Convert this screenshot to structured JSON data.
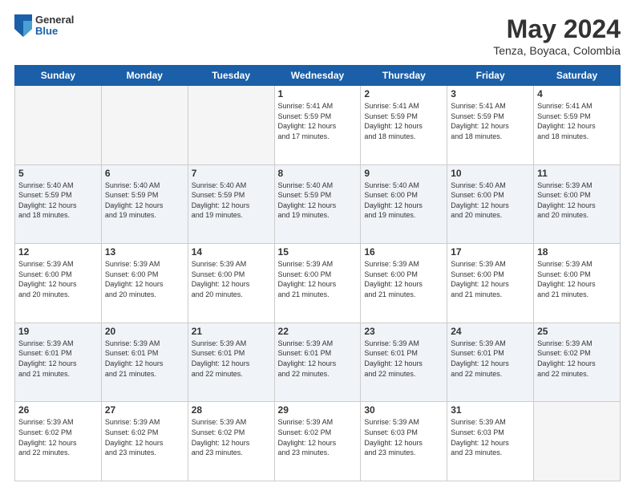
{
  "logo": {
    "general": "General",
    "blue": "Blue"
  },
  "header": {
    "title": "May 2024",
    "subtitle": "Tenza, Boyaca, Colombia"
  },
  "weekdays": [
    "Sunday",
    "Monday",
    "Tuesday",
    "Wednesday",
    "Thursday",
    "Friday",
    "Saturday"
  ],
  "weeks": [
    [
      {
        "day": "",
        "info": ""
      },
      {
        "day": "",
        "info": ""
      },
      {
        "day": "",
        "info": ""
      },
      {
        "day": "1",
        "info": "Sunrise: 5:41 AM\nSunset: 5:59 PM\nDaylight: 12 hours\nand 17 minutes."
      },
      {
        "day": "2",
        "info": "Sunrise: 5:41 AM\nSunset: 5:59 PM\nDaylight: 12 hours\nand 18 minutes."
      },
      {
        "day": "3",
        "info": "Sunrise: 5:41 AM\nSunset: 5:59 PM\nDaylight: 12 hours\nand 18 minutes."
      },
      {
        "day": "4",
        "info": "Sunrise: 5:41 AM\nSunset: 5:59 PM\nDaylight: 12 hours\nand 18 minutes."
      }
    ],
    [
      {
        "day": "5",
        "info": "Sunrise: 5:40 AM\nSunset: 5:59 PM\nDaylight: 12 hours\nand 18 minutes."
      },
      {
        "day": "6",
        "info": "Sunrise: 5:40 AM\nSunset: 5:59 PM\nDaylight: 12 hours\nand 19 minutes."
      },
      {
        "day": "7",
        "info": "Sunrise: 5:40 AM\nSunset: 5:59 PM\nDaylight: 12 hours\nand 19 minutes."
      },
      {
        "day": "8",
        "info": "Sunrise: 5:40 AM\nSunset: 5:59 PM\nDaylight: 12 hours\nand 19 minutes."
      },
      {
        "day": "9",
        "info": "Sunrise: 5:40 AM\nSunset: 6:00 PM\nDaylight: 12 hours\nand 19 minutes."
      },
      {
        "day": "10",
        "info": "Sunrise: 5:40 AM\nSunset: 6:00 PM\nDaylight: 12 hours\nand 20 minutes."
      },
      {
        "day": "11",
        "info": "Sunrise: 5:39 AM\nSunset: 6:00 PM\nDaylight: 12 hours\nand 20 minutes."
      }
    ],
    [
      {
        "day": "12",
        "info": "Sunrise: 5:39 AM\nSunset: 6:00 PM\nDaylight: 12 hours\nand 20 minutes."
      },
      {
        "day": "13",
        "info": "Sunrise: 5:39 AM\nSunset: 6:00 PM\nDaylight: 12 hours\nand 20 minutes."
      },
      {
        "day": "14",
        "info": "Sunrise: 5:39 AM\nSunset: 6:00 PM\nDaylight: 12 hours\nand 20 minutes."
      },
      {
        "day": "15",
        "info": "Sunrise: 5:39 AM\nSunset: 6:00 PM\nDaylight: 12 hours\nand 21 minutes."
      },
      {
        "day": "16",
        "info": "Sunrise: 5:39 AM\nSunset: 6:00 PM\nDaylight: 12 hours\nand 21 minutes."
      },
      {
        "day": "17",
        "info": "Sunrise: 5:39 AM\nSunset: 6:00 PM\nDaylight: 12 hours\nand 21 minutes."
      },
      {
        "day": "18",
        "info": "Sunrise: 5:39 AM\nSunset: 6:00 PM\nDaylight: 12 hours\nand 21 minutes."
      }
    ],
    [
      {
        "day": "19",
        "info": "Sunrise: 5:39 AM\nSunset: 6:01 PM\nDaylight: 12 hours\nand 21 minutes."
      },
      {
        "day": "20",
        "info": "Sunrise: 5:39 AM\nSunset: 6:01 PM\nDaylight: 12 hours\nand 21 minutes."
      },
      {
        "day": "21",
        "info": "Sunrise: 5:39 AM\nSunset: 6:01 PM\nDaylight: 12 hours\nand 22 minutes."
      },
      {
        "day": "22",
        "info": "Sunrise: 5:39 AM\nSunset: 6:01 PM\nDaylight: 12 hours\nand 22 minutes."
      },
      {
        "day": "23",
        "info": "Sunrise: 5:39 AM\nSunset: 6:01 PM\nDaylight: 12 hours\nand 22 minutes."
      },
      {
        "day": "24",
        "info": "Sunrise: 5:39 AM\nSunset: 6:01 PM\nDaylight: 12 hours\nand 22 minutes."
      },
      {
        "day": "25",
        "info": "Sunrise: 5:39 AM\nSunset: 6:02 PM\nDaylight: 12 hours\nand 22 minutes."
      }
    ],
    [
      {
        "day": "26",
        "info": "Sunrise: 5:39 AM\nSunset: 6:02 PM\nDaylight: 12 hours\nand 22 minutes."
      },
      {
        "day": "27",
        "info": "Sunrise: 5:39 AM\nSunset: 6:02 PM\nDaylight: 12 hours\nand 23 minutes."
      },
      {
        "day": "28",
        "info": "Sunrise: 5:39 AM\nSunset: 6:02 PM\nDaylight: 12 hours\nand 23 minutes."
      },
      {
        "day": "29",
        "info": "Sunrise: 5:39 AM\nSunset: 6:02 PM\nDaylight: 12 hours\nand 23 minutes."
      },
      {
        "day": "30",
        "info": "Sunrise: 5:39 AM\nSunset: 6:03 PM\nDaylight: 12 hours\nand 23 minutes."
      },
      {
        "day": "31",
        "info": "Sunrise: 5:39 AM\nSunset: 6:03 PM\nDaylight: 12 hours\nand 23 minutes."
      },
      {
        "day": "",
        "info": ""
      }
    ]
  ]
}
